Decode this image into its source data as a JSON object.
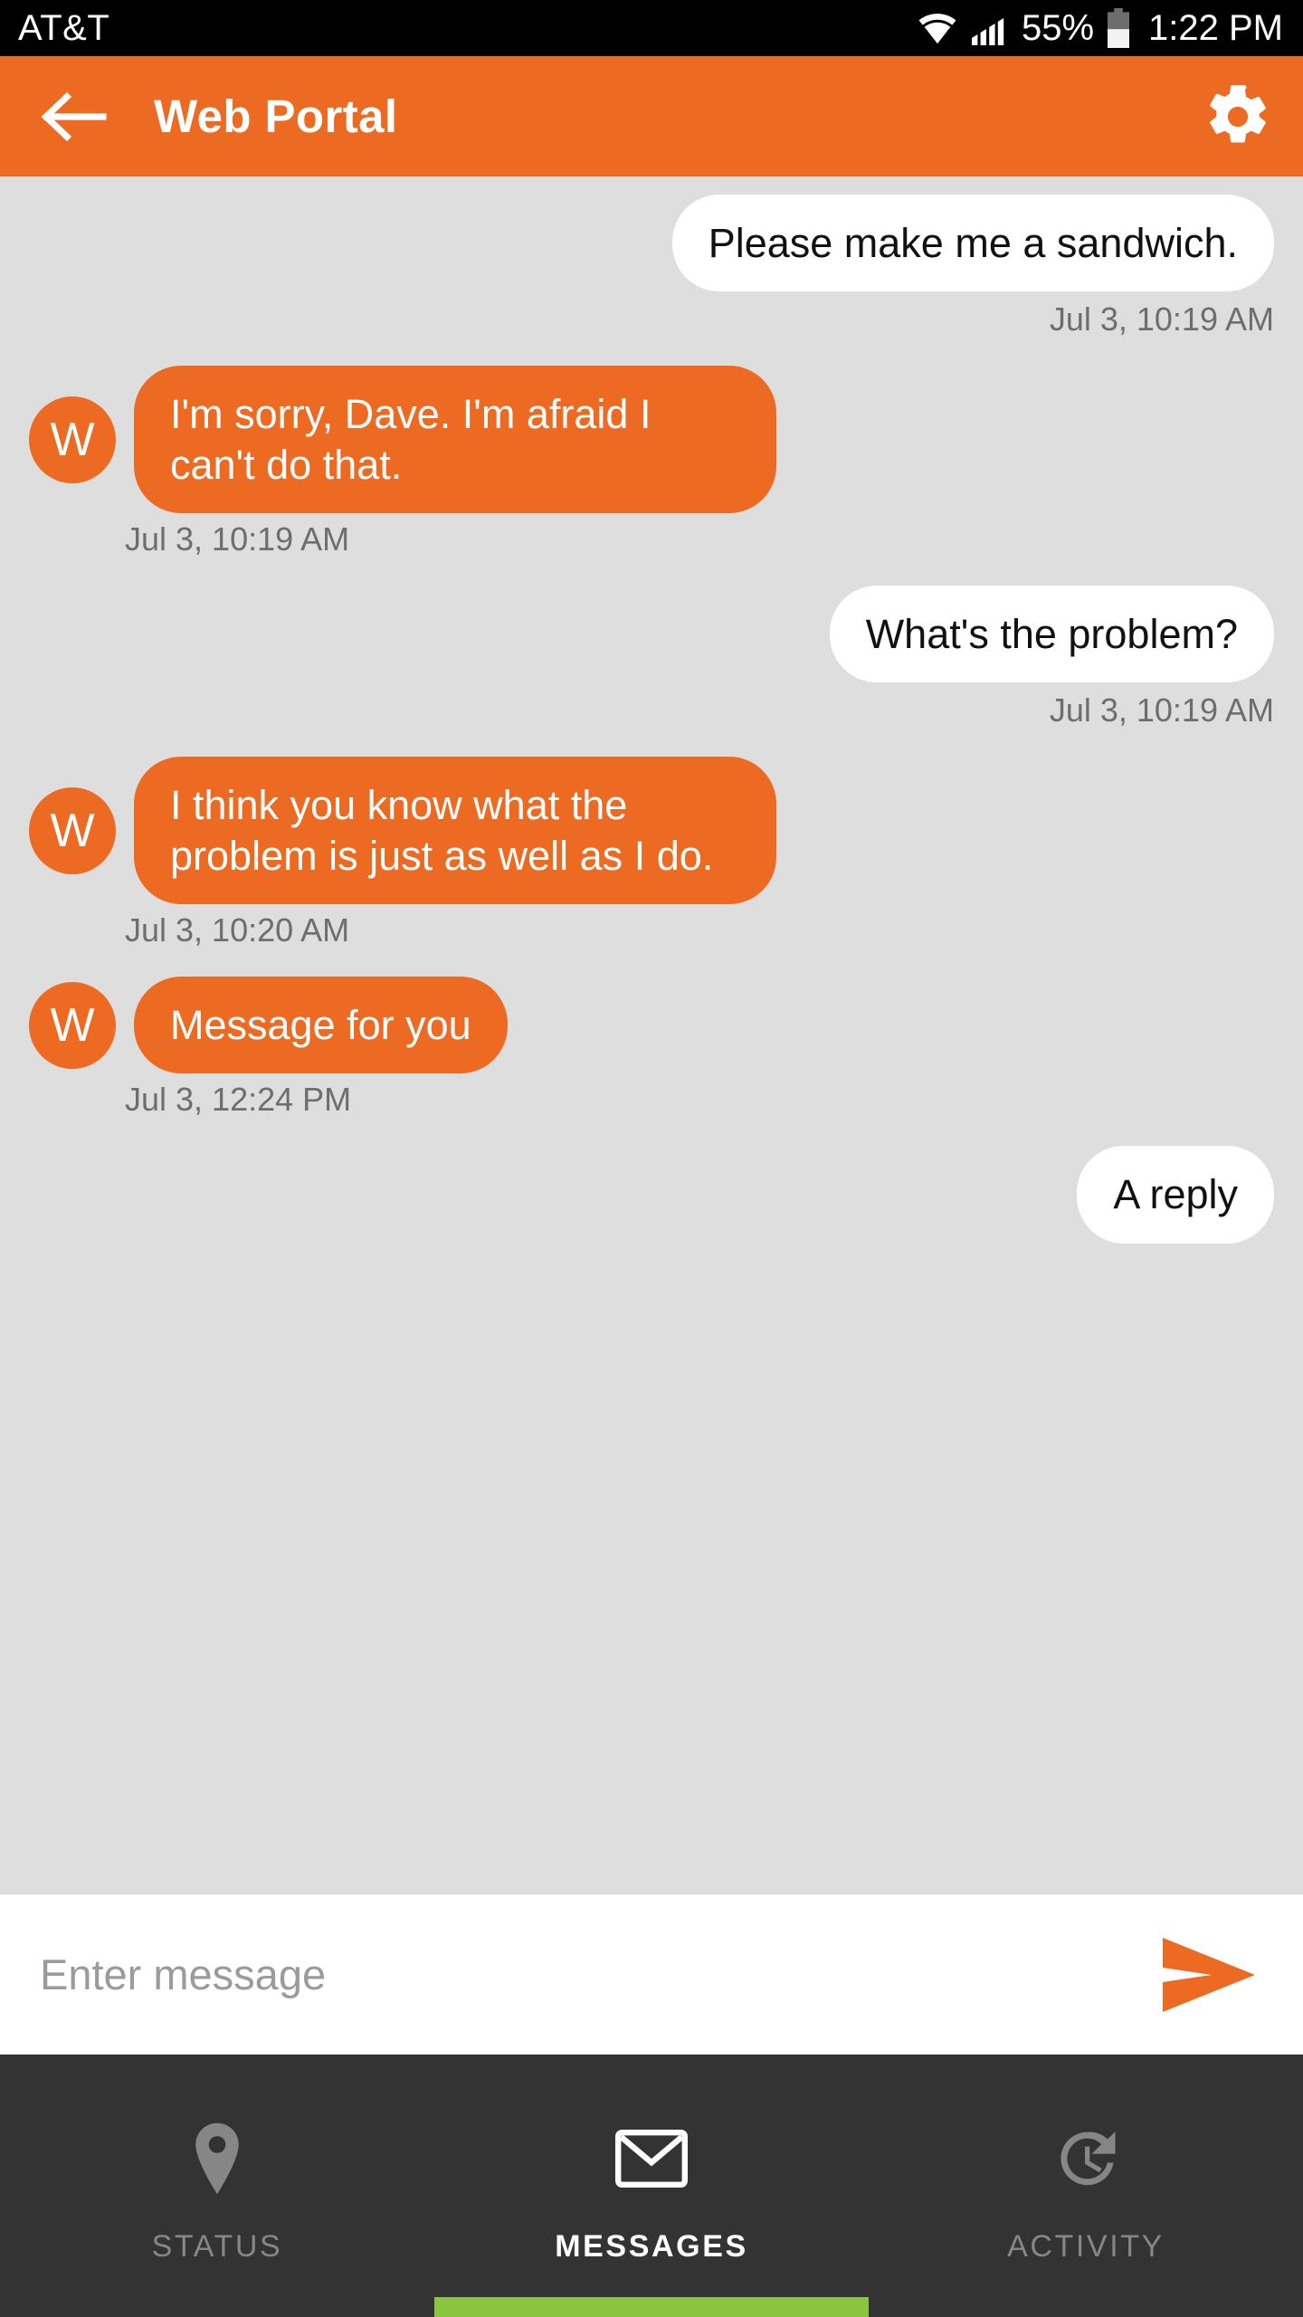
{
  "statusbar": {
    "carrier": "AT&T",
    "battery_percent": "55%",
    "time": "1:22 PM",
    "icons": {
      "wifi": "wifi-icon",
      "signal": "signal-bars-icon",
      "battery": "battery-icon"
    }
  },
  "appbar": {
    "title": "Web Portal",
    "back_icon": "back-arrow-icon",
    "settings_icon": "gear-icon",
    "background": "#ec6a22"
  },
  "chat": {
    "background": "#dedede",
    "avatar_initial": "W",
    "messages": [
      {
        "text": "Please make me a sandwich.",
        "timestamp": "Jul 3, 10:19 AM",
        "direction": "out"
      },
      {
        "text": "I'm sorry, Dave. I'm afraid I can't do that.",
        "timestamp": "Jul 3, 10:19 AM",
        "direction": "in"
      },
      {
        "text": "What's the problem?",
        "timestamp": "Jul 3, 10:19 AM",
        "direction": "out"
      },
      {
        "text": "I think you know what the problem is just as well as I do.",
        "timestamp": "Jul 3, 10:20 AM",
        "direction": "in"
      },
      {
        "text": "Message for you",
        "timestamp": "Jul 3, 12:24 PM",
        "direction": "in"
      },
      {
        "text": "A reply",
        "timestamp": "",
        "direction": "out",
        "clipped": true
      }
    ]
  },
  "composer": {
    "value": "",
    "placeholder": "Enter message",
    "send_icon": "send-arrow-icon",
    "send_color": "#ec6a22"
  },
  "bottomnav": {
    "background": "#333333",
    "active_indicator_color": "#8bc53f",
    "tabs": [
      {
        "label": "STATUS",
        "icon": "location-pin-icon",
        "active": false
      },
      {
        "label": "MESSAGES",
        "icon": "envelope-icon",
        "active": true
      },
      {
        "label": "ACTIVITY",
        "icon": "history-clock-icon",
        "active": false
      }
    ]
  }
}
